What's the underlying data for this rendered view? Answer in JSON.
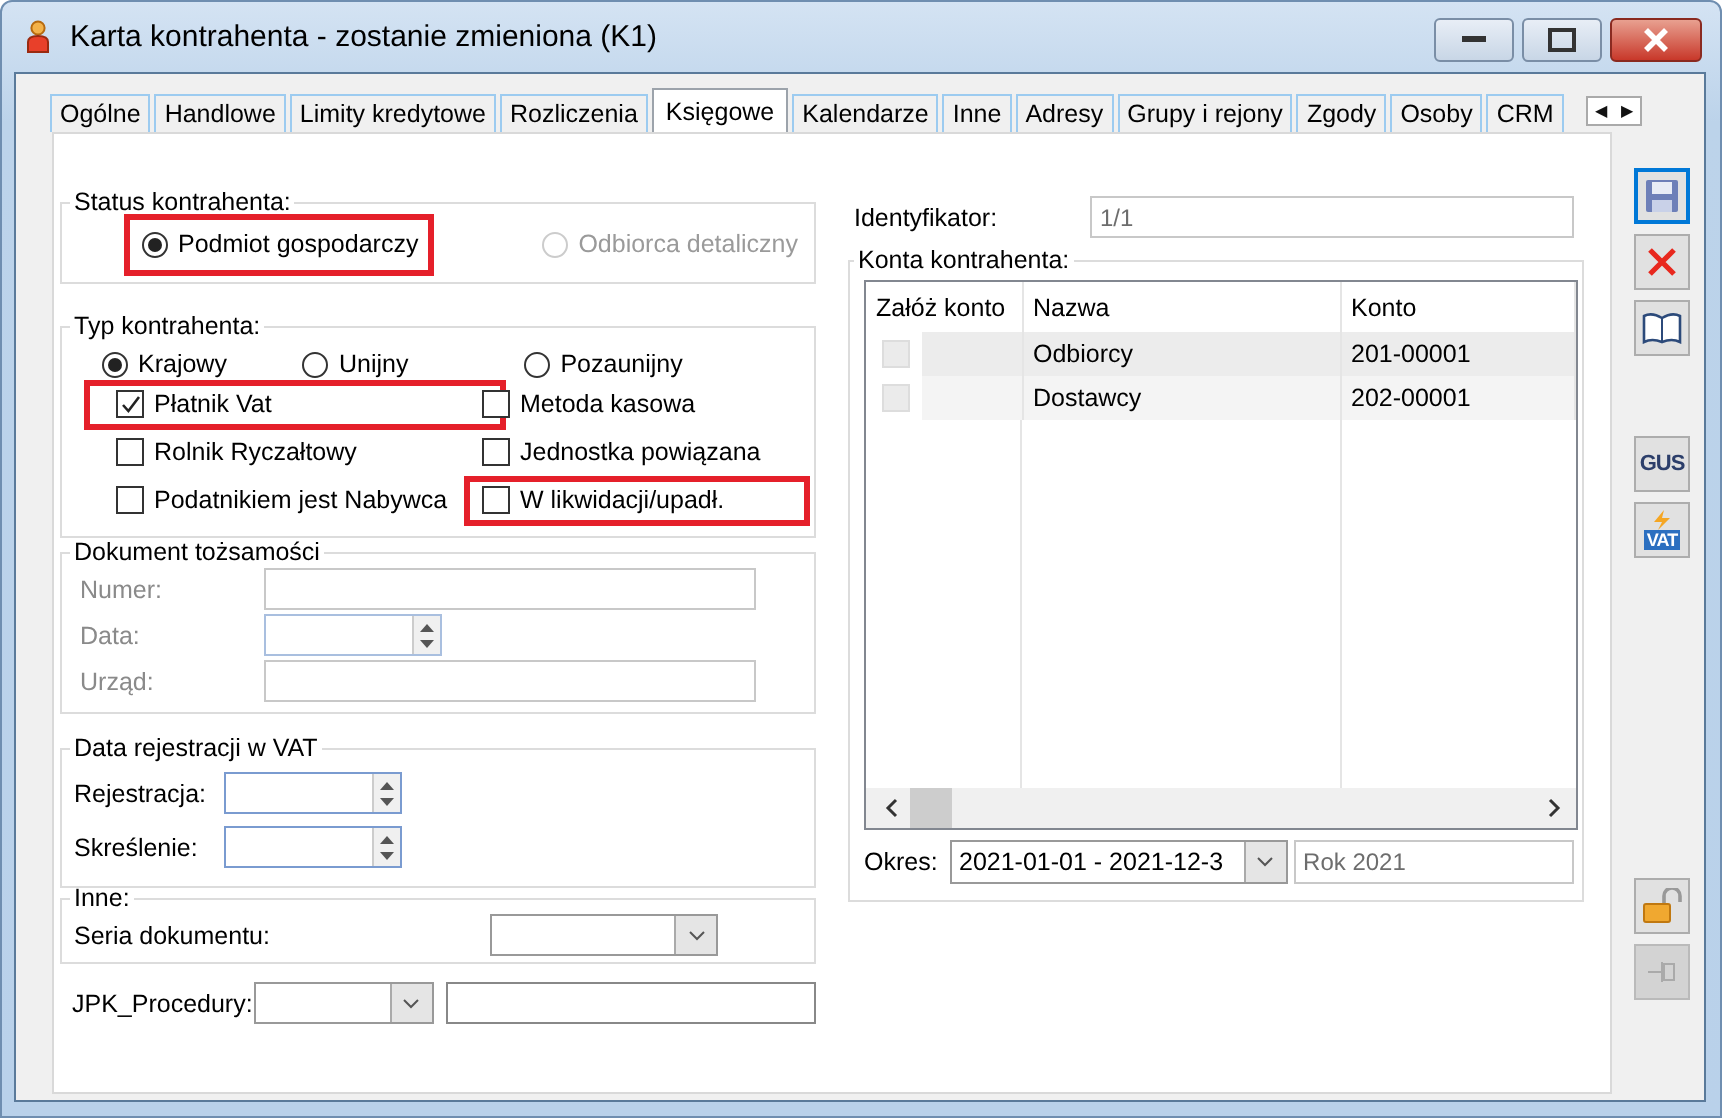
{
  "window": {
    "title": "Karta kontrahenta - zostanie zmieniona (K1)"
  },
  "title_buttons": [
    {
      "kind": "minimize"
    },
    {
      "kind": "maximize"
    },
    {
      "kind": "close"
    }
  ],
  "tabs": [
    {
      "label": "Ogólne",
      "selected": false
    },
    {
      "label": "Handlowe",
      "selected": false
    },
    {
      "label": "Limity kredytowe",
      "selected": false
    },
    {
      "label": "Rozliczenia",
      "selected": false
    },
    {
      "label": "Księgowe",
      "selected": true
    },
    {
      "label": "Kalendarze",
      "selected": false
    },
    {
      "label": "Inne",
      "selected": false
    },
    {
      "label": "Adresy",
      "selected": false
    },
    {
      "label": "Grupy i rejony",
      "selected": false
    },
    {
      "label": "Zgody",
      "selected": false
    },
    {
      "label": "Osoby",
      "selected": false
    },
    {
      "label": "CRM",
      "selected": false
    }
  ],
  "tab_scroll": [
    "◀",
    "▶"
  ],
  "status": {
    "legend": "Status kontrahenta:",
    "options": [
      {
        "label": "Podmiot gospodarczy",
        "selected": true,
        "disabled": false,
        "highlighted": true
      },
      {
        "label": "Odbiorca detaliczny",
        "selected": false,
        "disabled": true,
        "highlighted": false
      }
    ]
  },
  "type": {
    "legend": "Typ kontrahenta:",
    "options": [
      {
        "label": "Krajowy",
        "selected": true
      },
      {
        "label": "Unijny",
        "selected": false
      },
      {
        "label": "Pozaunijny",
        "selected": false
      }
    ],
    "flags": [
      {
        "label": "Płatnik Vat",
        "checked": true,
        "highlighted": true
      },
      {
        "label": "Metoda kasowa",
        "checked": false,
        "highlighted": false
      },
      {
        "label": "Rolnik Ryczałtowy",
        "checked": false,
        "highlighted": false
      },
      {
        "label": "Jednostka powiązana",
        "checked": false,
        "highlighted": false
      },
      {
        "label": "Podatnikiem jest Nabywca",
        "checked": false,
        "highlighted": false
      },
      {
        "label": "W likwidacji/upadł.",
        "checked": false,
        "highlighted": true
      }
    ]
  },
  "identity_document": {
    "legend": "Dokument tożsamości",
    "fields": [
      {
        "label": "Numer:",
        "kind": "text",
        "disabled": true
      },
      {
        "label": "Data:",
        "kind": "date",
        "disabled": true
      },
      {
        "label": "Urząd:",
        "kind": "text",
        "disabled": true
      }
    ]
  },
  "vat_registration": {
    "legend": "Data rejestracji w VAT",
    "fields": [
      {
        "label": "Rejestracja:",
        "kind": "date",
        "disabled": false
      },
      {
        "label": "Skreślenie:",
        "kind": "date",
        "disabled": false
      }
    ]
  },
  "other": {
    "legend": "Inne:",
    "fields": [
      {
        "label": "Seria dokumentu:",
        "kind": "combo",
        "disabled": false
      }
    ]
  },
  "jpk": {
    "label": "JPK_Procedury:"
  },
  "identifier": {
    "label": "Identyfikator:",
    "value": "1/1"
  },
  "accounts": {
    "legend": "Konta kontrahenta:",
    "columns": [
      "Załóż konto",
      "Nazwa",
      "Konto"
    ],
    "rows": [
      {
        "create": false,
        "name": "Odbiorcy",
        "account": "201-00001"
      },
      {
        "create": false,
        "name": "Dostawcy",
        "account": "202-00001"
      }
    ],
    "period": {
      "label": "Okres:",
      "value": "2021-01-01 - 2021-12-3",
      "description": "Rok 2021"
    }
  },
  "toolbar": [
    {
      "kind": "save",
      "focused": true,
      "disabled": false
    },
    {
      "kind": "delete",
      "focused": false,
      "disabled": false
    },
    {
      "kind": "book",
      "focused": false,
      "disabled": false
    },
    {
      "kind": "gus",
      "label": "GUS",
      "focused": false,
      "disabled": false
    },
    {
      "kind": "vat",
      "label": "VAT",
      "focused": false,
      "disabled": false
    },
    {
      "kind": "unlock",
      "focused": false,
      "disabled": false
    },
    {
      "kind": "pin",
      "focused": false,
      "disabled": true
    }
  ]
}
